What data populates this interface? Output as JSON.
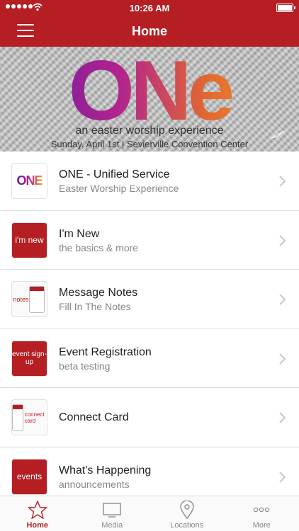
{
  "status_bar": {
    "time": "10:26 AM"
  },
  "nav": {
    "title": "Home"
  },
  "banner": {
    "logo_text": "ONe",
    "tagline": "an easter worship experience",
    "date_line": "Sunday, April 1st | Sevierville Convention Center"
  },
  "items": [
    {
      "title": "ONE - Unified Service",
      "subtitle": "Easter Worship Experience",
      "thumb_text": "ONE"
    },
    {
      "title": "I'm New",
      "subtitle": "the basics & more",
      "thumb_text": "i'm new"
    },
    {
      "title": "Message Notes",
      "subtitle": "Fill In The Notes",
      "thumb_text": "notes"
    },
    {
      "title": "Event Registration",
      "subtitle": "beta testing",
      "thumb_text": "event sign-up"
    },
    {
      "title": "Connect Card",
      "subtitle": "",
      "thumb_text": "connect card"
    },
    {
      "title": "What's Happening",
      "subtitle": "announcements",
      "thumb_text": "events"
    }
  ],
  "tabs": [
    {
      "label": "Home",
      "icon": "star-icon",
      "active": true
    },
    {
      "label": "Media",
      "icon": "tv-icon",
      "active": false
    },
    {
      "label": "Locations",
      "icon": "map-pin-icon",
      "active": false
    },
    {
      "label": "More",
      "icon": "more-dots-icon",
      "active": false
    }
  ],
  "colors": {
    "brand_red": "#b51f24",
    "tab_inactive": "#8a8a8a"
  }
}
